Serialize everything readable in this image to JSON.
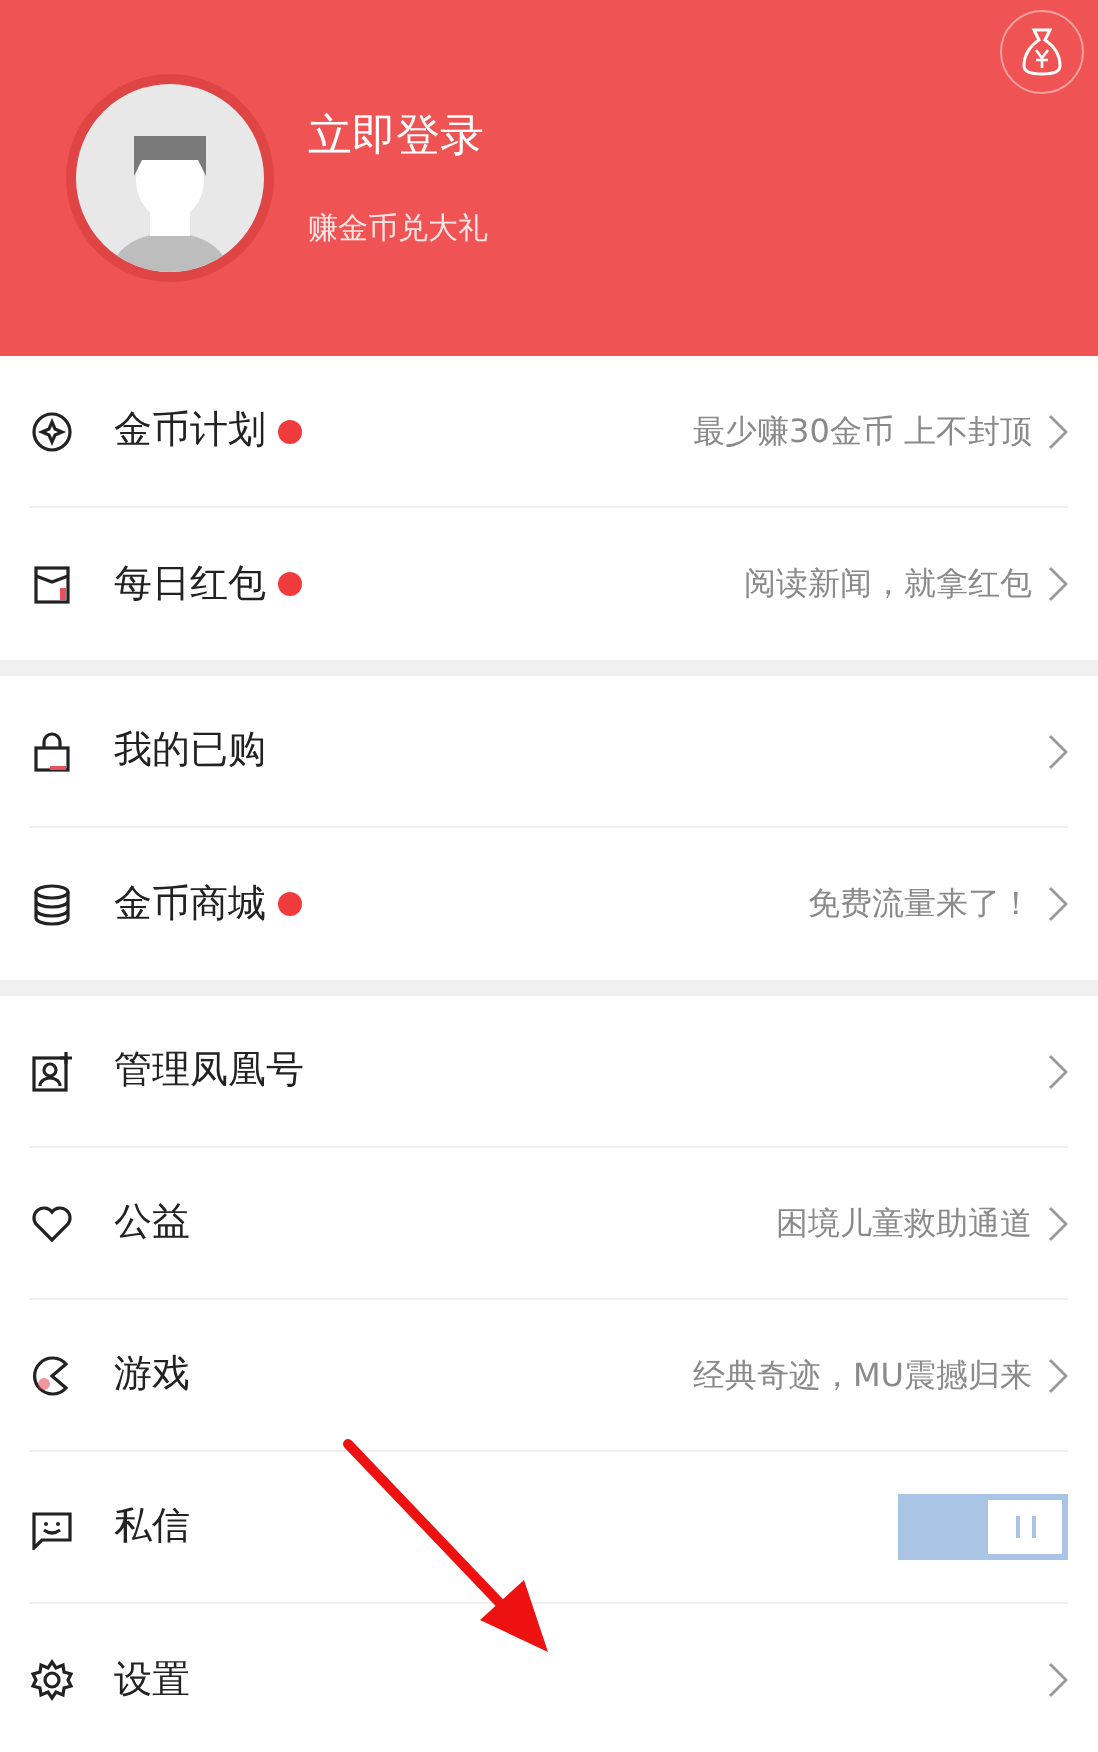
{
  "header": {
    "title": "立即登录",
    "subtitle": "赚金币兑大礼"
  },
  "sections": [
    {
      "items": [
        {
          "kind": "link",
          "label": "金币计划",
          "badge": true,
          "detail": "最少赚30金币 上不封顶"
        },
        {
          "kind": "link",
          "label": "每日红包",
          "badge": true,
          "detail": "阅读新闻，就拿红包"
        }
      ]
    },
    {
      "items": [
        {
          "kind": "link",
          "label": "我的已购",
          "badge": false
        },
        {
          "kind": "link",
          "label": "金币商城",
          "badge": true,
          "detail": "免费流量来了！"
        }
      ]
    },
    {
      "items": [
        {
          "kind": "link",
          "label": "管理凤凰号",
          "badge": false
        },
        {
          "kind": "link",
          "label": "公益",
          "badge": false,
          "detail": "困境儿童救助通道"
        },
        {
          "kind": "link",
          "label": "游戏",
          "badge": false,
          "detail": "经典奇迹，MU震撼归来"
        },
        {
          "kind": "toggle",
          "label": "私信",
          "on": true
        },
        {
          "kind": "link",
          "label": "设置",
          "badge": false
        }
      ]
    }
  ]
}
